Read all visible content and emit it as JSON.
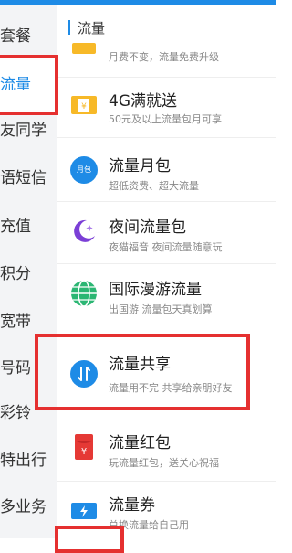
{
  "sidebar": {
    "items": [
      {
        "label": "套餐"
      },
      {
        "label": "流量"
      },
      {
        "label": "友同学"
      },
      {
        "label": "语短信"
      },
      {
        "label": "充值"
      },
      {
        "label": "积分"
      },
      {
        "label": "宽带"
      },
      {
        "label": "号码"
      },
      {
        "label": "彩铃"
      },
      {
        "label": "特出行"
      },
      {
        "label": "多业务"
      }
    ]
  },
  "main": {
    "section_title": "流量",
    "items": [
      {
        "title": "",
        "subtitle": "月费不变，流量免费升级",
        "icon": "upgrade-icon"
      },
      {
        "title": "4G满就送",
        "subtitle": "50元及以上流量包月可享",
        "icon": "coupon-icon"
      },
      {
        "title": "流量月包",
        "subtitle": "超低资费、超大流量",
        "icon": "monthly-package-icon",
        "icon_text": "月包"
      },
      {
        "title": "夜间流量包",
        "subtitle": "夜猫福音 夜间流量随意玩",
        "icon": "moon-icon"
      },
      {
        "title": "国际漫游流量",
        "subtitle": "出国游 流量包天真划算",
        "icon": "globe-icon"
      },
      {
        "title": "流量共享",
        "subtitle": "流量用不完 共享给亲朋好友",
        "icon": "share-icon"
      },
      {
        "title": "流量红包",
        "subtitle": "玩流量红包，送关心祝福",
        "icon": "red-envelope-icon"
      },
      {
        "title": "流量券",
        "subtitle": "兑换流量给自己用",
        "icon": "voucher-icon"
      }
    ]
  },
  "colors": {
    "accent": "#1e8be6",
    "highlight_box": "#e53030"
  }
}
